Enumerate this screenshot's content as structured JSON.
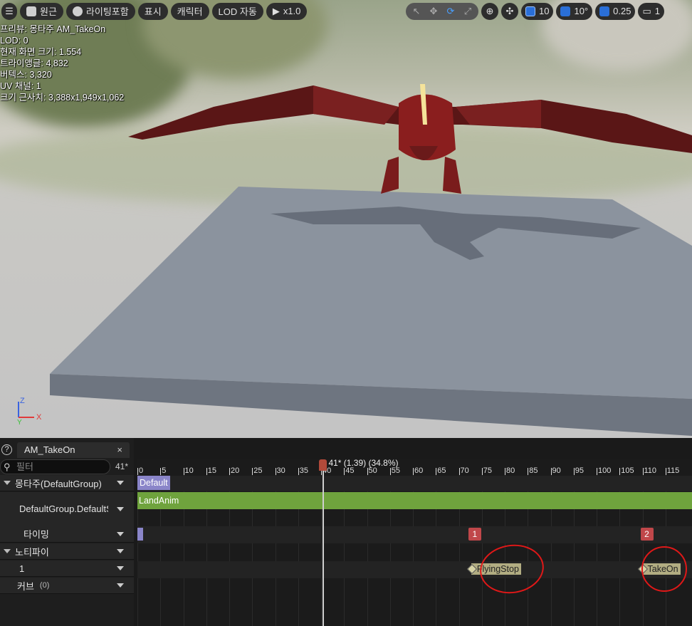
{
  "toolbar": {
    "menu_icon": "hamburger-icon",
    "perspective": "원근",
    "lighting": "라이팅포함",
    "show": "표시",
    "character": "캐릭터",
    "lod": "LOD 자동",
    "play_speed": "x1.0",
    "grid_snap": "10",
    "rotation_snap": "10°",
    "scale_snap": "0.25",
    "camera_speed": "1"
  },
  "stats": {
    "preview": "프리뷰: 몽타주 AM_TakeOn",
    "lod": "LOD: 0",
    "screen_size": "현재 화면 크기: 1.554",
    "triangles": "트라이앵글: 4,832",
    "vertices": "버텍스: 3,320",
    "uv_channels": "UV 채널: 1",
    "approx_size": "크기 근사치: 3,388x1,949x1,062"
  },
  "axis": {
    "z": "Z",
    "x": "X",
    "y": "Y"
  },
  "panel": {
    "tab_title": "AM_TakeOn",
    "tab_close": "×",
    "help": "?",
    "filter_placeholder": "필터",
    "frame_label": "41*",
    "rows": {
      "montage": "몽타주(DefaultGroup)",
      "slot": "DefaultGroup.DefaultS",
      "timing": "타이밍",
      "notifies": "노티파이",
      "notify_track": "1",
      "curves": "커브",
      "curves_count": "(0)"
    }
  },
  "timeline": {
    "ticks": [
      "0",
      "5",
      "10",
      "15",
      "20",
      "25",
      "30",
      "35",
      "40",
      "45",
      "50",
      "55",
      "60",
      "65",
      "70",
      "75",
      "80",
      "85",
      "90",
      "95",
      "100",
      "105",
      "110",
      "115"
    ],
    "playhead_label": "41* (1.39) (34.8%)",
    "playhead_frame": 41,
    "section_name": "Default",
    "anim_segment": "LandAnim",
    "timing_markers": [
      "1",
      "2"
    ],
    "notifies": [
      {
        "name": "FlyingStop",
        "frame": 73
      },
      {
        "name": "TakeOn",
        "frame": 110
      }
    ]
  },
  "colors": {
    "accent": "#2a6fd8",
    "anim_segment": "#6fa33d",
    "section": "#8a85c9",
    "marker": "#c0474a",
    "annotation": "#e01818"
  }
}
